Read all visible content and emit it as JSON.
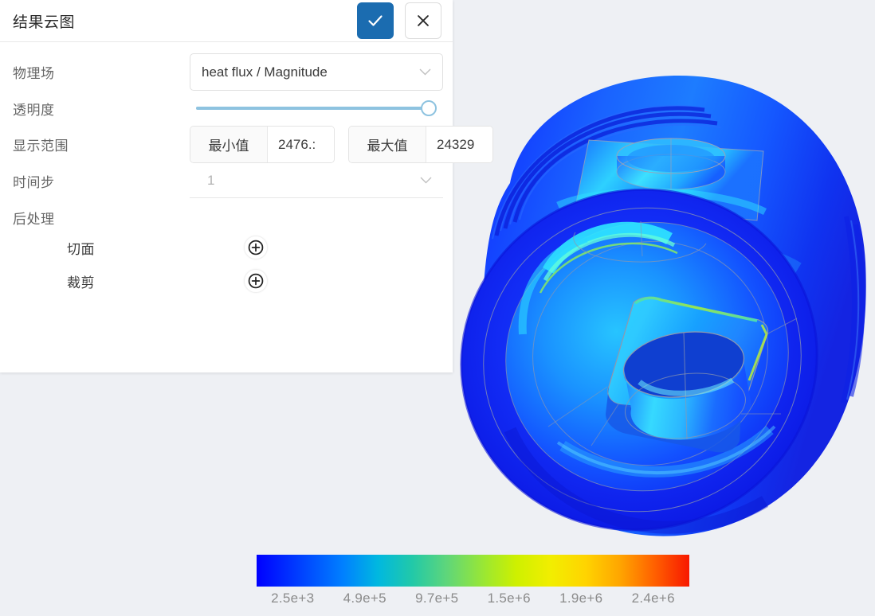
{
  "window": {
    "background_color": "#eef0f4"
  },
  "panel": {
    "title": "结果云图",
    "confirm_label": "✓",
    "cancel_label": "✕",
    "accent_color": "#1b6cb0",
    "fields": {
      "physics_field": {
        "label": "物理场",
        "value": "heat flux / Magnitude"
      },
      "transparency": {
        "label": "透明度",
        "value": 100,
        "track_color": "#8ec3e0"
      },
      "display_range": {
        "label": "显示范围",
        "min_addon": "最小值",
        "min_value": "2476.:",
        "max_addon": "最大值",
        "max_value": "24329"
      },
      "time_step": {
        "label": "时间步",
        "value": "1"
      }
    },
    "post_process": {
      "title": "后处理",
      "items": [
        {
          "label": "切面",
          "action_icon": "plus-circle-icon"
        },
        {
          "label": "裁剪",
          "action_icon": "plus-circle-icon"
        }
      ]
    }
  },
  "chart_data": {
    "type": "heatmap",
    "title": "",
    "colorbar": {
      "orientation": "horizontal",
      "colormap": "jet",
      "tick_labels": [
        "2.5e+3",
        "4.9e+5",
        "9.7e+5",
        "1.5e+6",
        "1.9e+6",
        "2.4e+6"
      ],
      "tick_values": [
        2500,
        490000,
        970000,
        1500000,
        1900000,
        2400000
      ],
      "range_min": 2476.3,
      "range_max": 2432900,
      "unit": "heat flux / Magnitude",
      "stops": [
        "#0000ff",
        "#0080ff",
        "#00b8e0",
        "#5fd67a",
        "#9ee82f",
        "#f2ee00",
        "#ffa500",
        "#f81800"
      ]
    },
    "model": {
      "description": "3D cylindrical bearing-housing part shaded by heat flux magnitude",
      "dominant_color": "#1a4cf5"
    }
  }
}
